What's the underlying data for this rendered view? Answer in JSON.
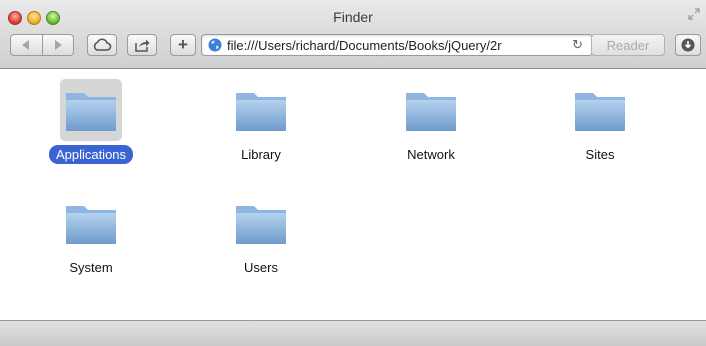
{
  "window": {
    "title": "Finder"
  },
  "toolbar": {
    "back_icon": "back-arrow-icon",
    "forward_icon": "forward-arrow-icon",
    "icloud_icon": "cloud-icon",
    "share_icon": "share-icon",
    "add_label": "+",
    "address": "file:///Users/richard/Documents/Books/jQuery/2r",
    "reload_glyph": "↻",
    "reader_label": "Reader",
    "downloads_icon": "download-icon"
  },
  "items": [
    {
      "label": "Applications",
      "selected": true
    },
    {
      "label": "Library",
      "selected": false
    },
    {
      "label": "Network",
      "selected": false
    },
    {
      "label": "Sites",
      "selected": false
    },
    {
      "label": "System",
      "selected": false
    },
    {
      "label": "Users",
      "selected": false
    }
  ],
  "colors": {
    "selection": "#3a64d4",
    "folder_top": "#a9c9ea",
    "folder_bottom": "#6f9ccd"
  }
}
